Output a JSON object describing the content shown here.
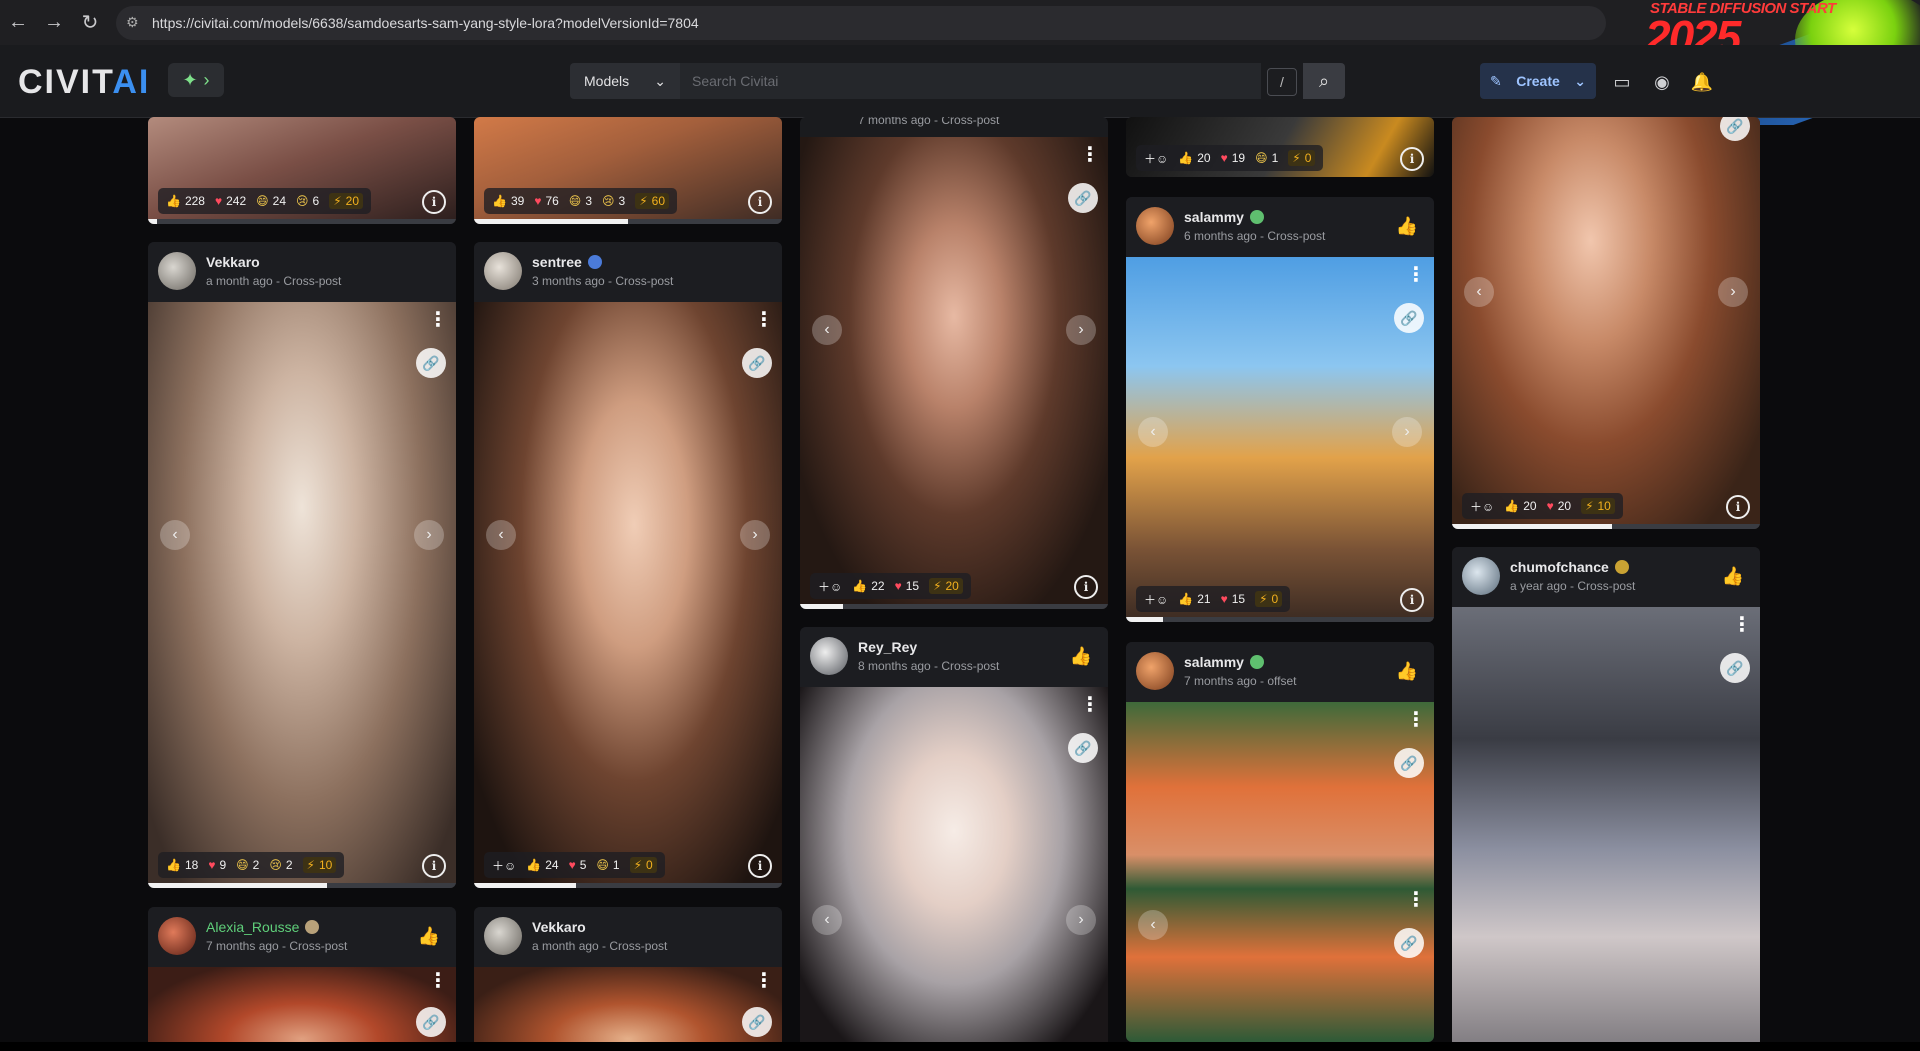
{
  "browser": {
    "url": "https://civitai.com/models/6638/samdoesarts-sam-yang-style-lora?modelVersionId=7804",
    "banner_line1": "STABLE DIFFUSION START",
    "banner_line2": "2025"
  },
  "header": {
    "logo_main": "CIVIT",
    "logo_accent": "AI",
    "models_label": "Models",
    "search_placeholder": "Search Civitai",
    "slash_hint": "/",
    "create_label": "Create"
  },
  "colors": {
    "brand_blue": "#3b8ff0",
    "like_green": "#3fcf6a",
    "heart_red": "#ff4a5e",
    "buzz_gold": "#f2b01e"
  },
  "cards": {
    "c1_top": {
      "likes": "228",
      "hearts": "242",
      "laugh": "24",
      "cry": "6",
      "buzz": "20"
    },
    "c2_top": {
      "likes": "39",
      "hearts": "76",
      "laugh": "3",
      "cry": "3",
      "buzz": "60"
    },
    "c3": {
      "meta": "7 months ago - Cross-post",
      "likes": "22",
      "hearts": "15",
      "buzz": "20"
    },
    "c4_top": {
      "likes": "20",
      "hearts": "19",
      "laugh": "1",
      "buzz": "0"
    },
    "c5_top": {
      "likes": "20",
      "hearts": "20",
      "buzz": "10"
    },
    "c6": {
      "user": "Vekkaro",
      "meta": "a month ago - Cross-post",
      "likes": "18",
      "hearts": "9",
      "laugh": "2",
      "cry": "2",
      "buzz": "10"
    },
    "c7": {
      "user": "sentree",
      "meta": "3 months ago - Cross-post",
      "likes": "24",
      "hearts": "5",
      "laugh": "1",
      "buzz": "0"
    },
    "c8": {
      "user": "salammy",
      "meta": "6 months ago - Cross-post",
      "likes": "21",
      "hearts": "15",
      "buzz": "0"
    },
    "c9": {
      "user": "chumofchance",
      "meta": "a year ago - Cross-post"
    },
    "c10": {
      "user": "Rey_Rey",
      "meta": "8 months ago - Cross-post"
    },
    "c11": {
      "user": "salammy",
      "meta": "7 months ago - offset"
    },
    "c12": {
      "user": "Alexia_Rousse",
      "meta": "7 months ago - Cross-post"
    },
    "c13": {
      "user": "Vekkaro",
      "meta": "a month ago - Cross-post"
    }
  },
  "icons": {
    "back": "←",
    "forward": "→",
    "reload": "↻",
    "chevron": "⌄",
    "search": "⌕",
    "link": "🔗",
    "thumb": "👍",
    "heart": "♥",
    "smile": "😀",
    "bolt": "⚡",
    "info": "i",
    "dots": "⋮",
    "left": "‹",
    "right": "›",
    "bell": "🔔",
    "like": "👍"
  }
}
